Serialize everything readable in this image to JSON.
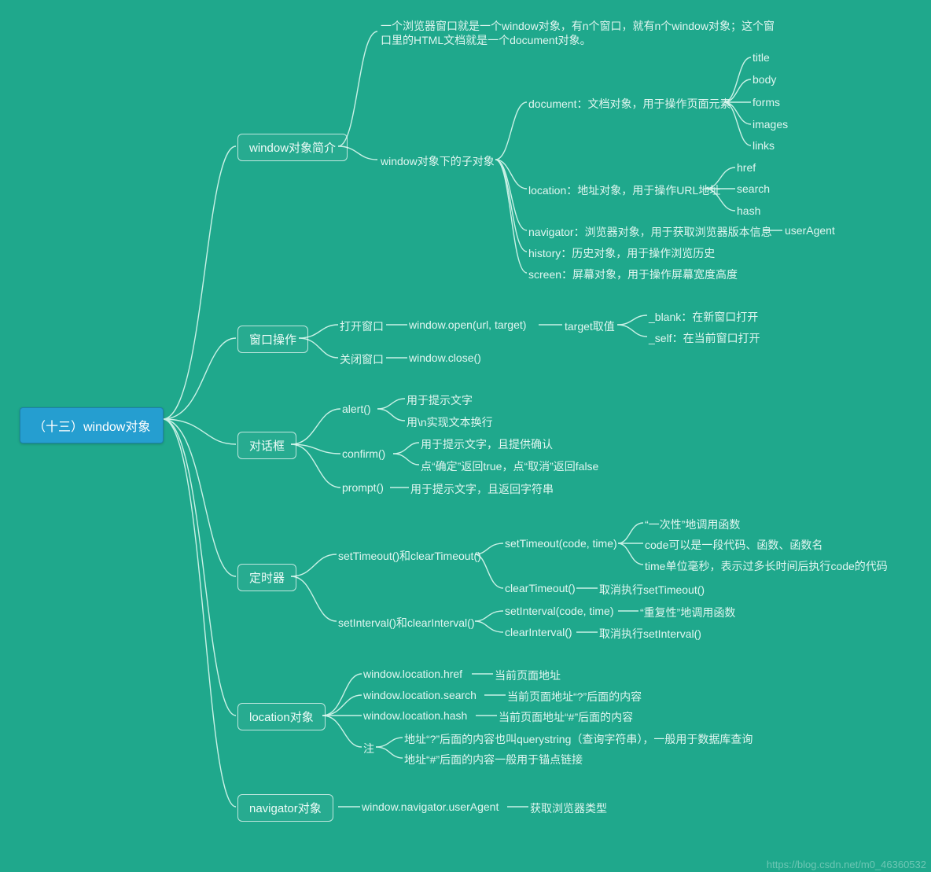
{
  "root": {
    "label": "（十三）window对象"
  },
  "branches": {
    "b1": {
      "label": "window对象简介"
    },
    "b2": {
      "label": "窗口操作"
    },
    "b3": {
      "label": "对话框"
    },
    "b4": {
      "label": "定时器"
    },
    "b5": {
      "label": "location对象"
    },
    "b6": {
      "label": "navigator对象"
    }
  },
  "c": {
    "b1_desc1": "一个浏览器窗口就是一个window对象，有n个窗口，就有n个window对象；这个窗",
    "b1_desc2": "口里的HTML文档就是一个document对象。",
    "b1_sub": "window对象下的子对象",
    "b1_doc": "document：文档对象，用于操作页面元素",
    "b1_doc_title": "title",
    "b1_doc_body": "body",
    "b1_doc_forms": "forms",
    "b1_doc_images": "images",
    "b1_doc_links": "links",
    "b1_loc": "location：地址对象，用于操作URL地址",
    "b1_loc_href": "href",
    "b1_loc_search": "search",
    "b1_loc_hash": "hash",
    "b1_nav": "navigator：浏览器对象，用于获取浏览器版本信息",
    "b1_nav_ua": "userAgent",
    "b1_his": "history：历史对象，用于操作浏览历史",
    "b1_scr": "screen：屏幕对象，用于操作屏幕宽度高度",
    "b2_open": "打开窗口",
    "b2_open_fn": "window.open(url, target)",
    "b2_open_tgt": "target取值",
    "b2_blank": "_blank：在新窗口打开",
    "b2_self": "_self：在当前窗口打开",
    "b2_close": "关闭窗口",
    "b2_close_fn": "window.close()",
    "b3_alert": "alert()",
    "b3_alert1": "用于提示文字",
    "b3_alert2": "用\\n实现文本换行",
    "b3_confirm": "confirm()",
    "b3_confirm1": "用于提示文字，且提供确认",
    "b3_confirm2": "点“确定”返回true，点“取消”返回false",
    "b3_prompt": "prompt()",
    "b3_prompt1": "用于提示文字，且返回字符串",
    "b4_set": "setTimeout()和clearTimeout()",
    "b4_set_call": "setTimeout(code, time)",
    "b4_set_a": "“一次性”地调用函数",
    "b4_set_b": "code可以是一段代码、函数、函数名",
    "b4_set_c": "time单位毫秒，表示过多长时间后执行code的代码",
    "b4_clr": "clearTimeout()",
    "b4_clr_d": "取消执行setTimeout()",
    "b4_int": "setInterval()和clearInterval()",
    "b4_int_call": "setInterval(code, time)",
    "b4_int_d": "“重复性”地调用函数",
    "b4_cint": "clearInterval()",
    "b4_cint_d": "取消执行setInterval()",
    "b5_href": "window.location.href",
    "b5_href_d": "当前页面地址",
    "b5_search": "window.location.search",
    "b5_search_d": "当前页面地址“?”后面的内容",
    "b5_hash": "window.location.hash",
    "b5_hash_d": "当前页面地址“#”后面的内容",
    "b5_note": "注",
    "b5_note1": "地址“?”后面的内容也叫querystring（查询字符串），一般用于数据库查询",
    "b5_note2": "地址“#”后面的内容一般用于锚点链接",
    "b6_ua": "window.navigator.userAgent",
    "b6_ua_d": "获取浏览器类型"
  },
  "watermark": "https://blog.csdn.net/m0_46360532"
}
